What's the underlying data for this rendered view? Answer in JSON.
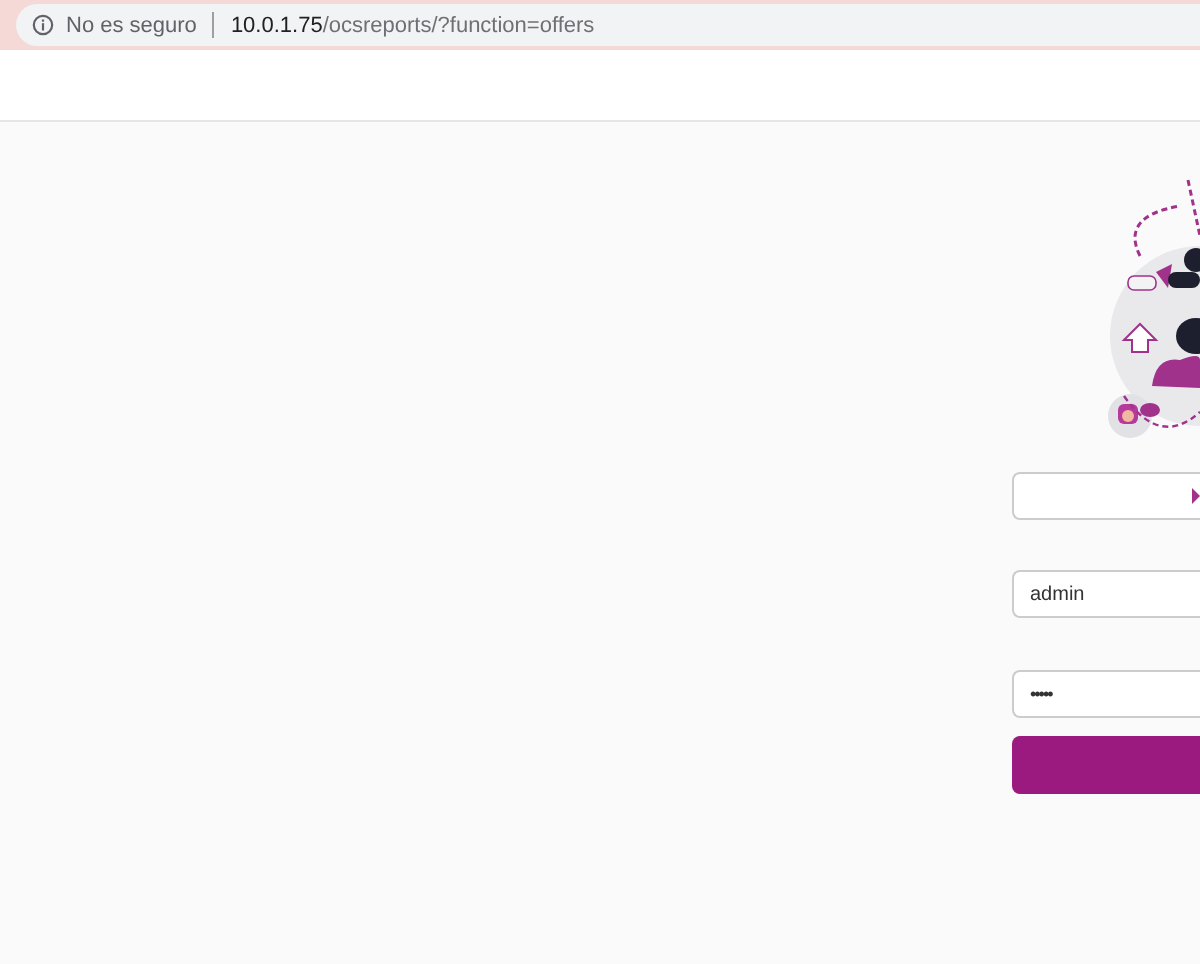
{
  "browser": {
    "security_label": "No es seguro",
    "url_host": "10.0.1.75",
    "url_path": "/ocsreports/?function=offers"
  },
  "login": {
    "fields": [
      {
        "kind": "select"
      },
      {
        "kind": "text",
        "value": "admin"
      },
      {
        "kind": "password",
        "value": "•••••"
      }
    ]
  }
}
